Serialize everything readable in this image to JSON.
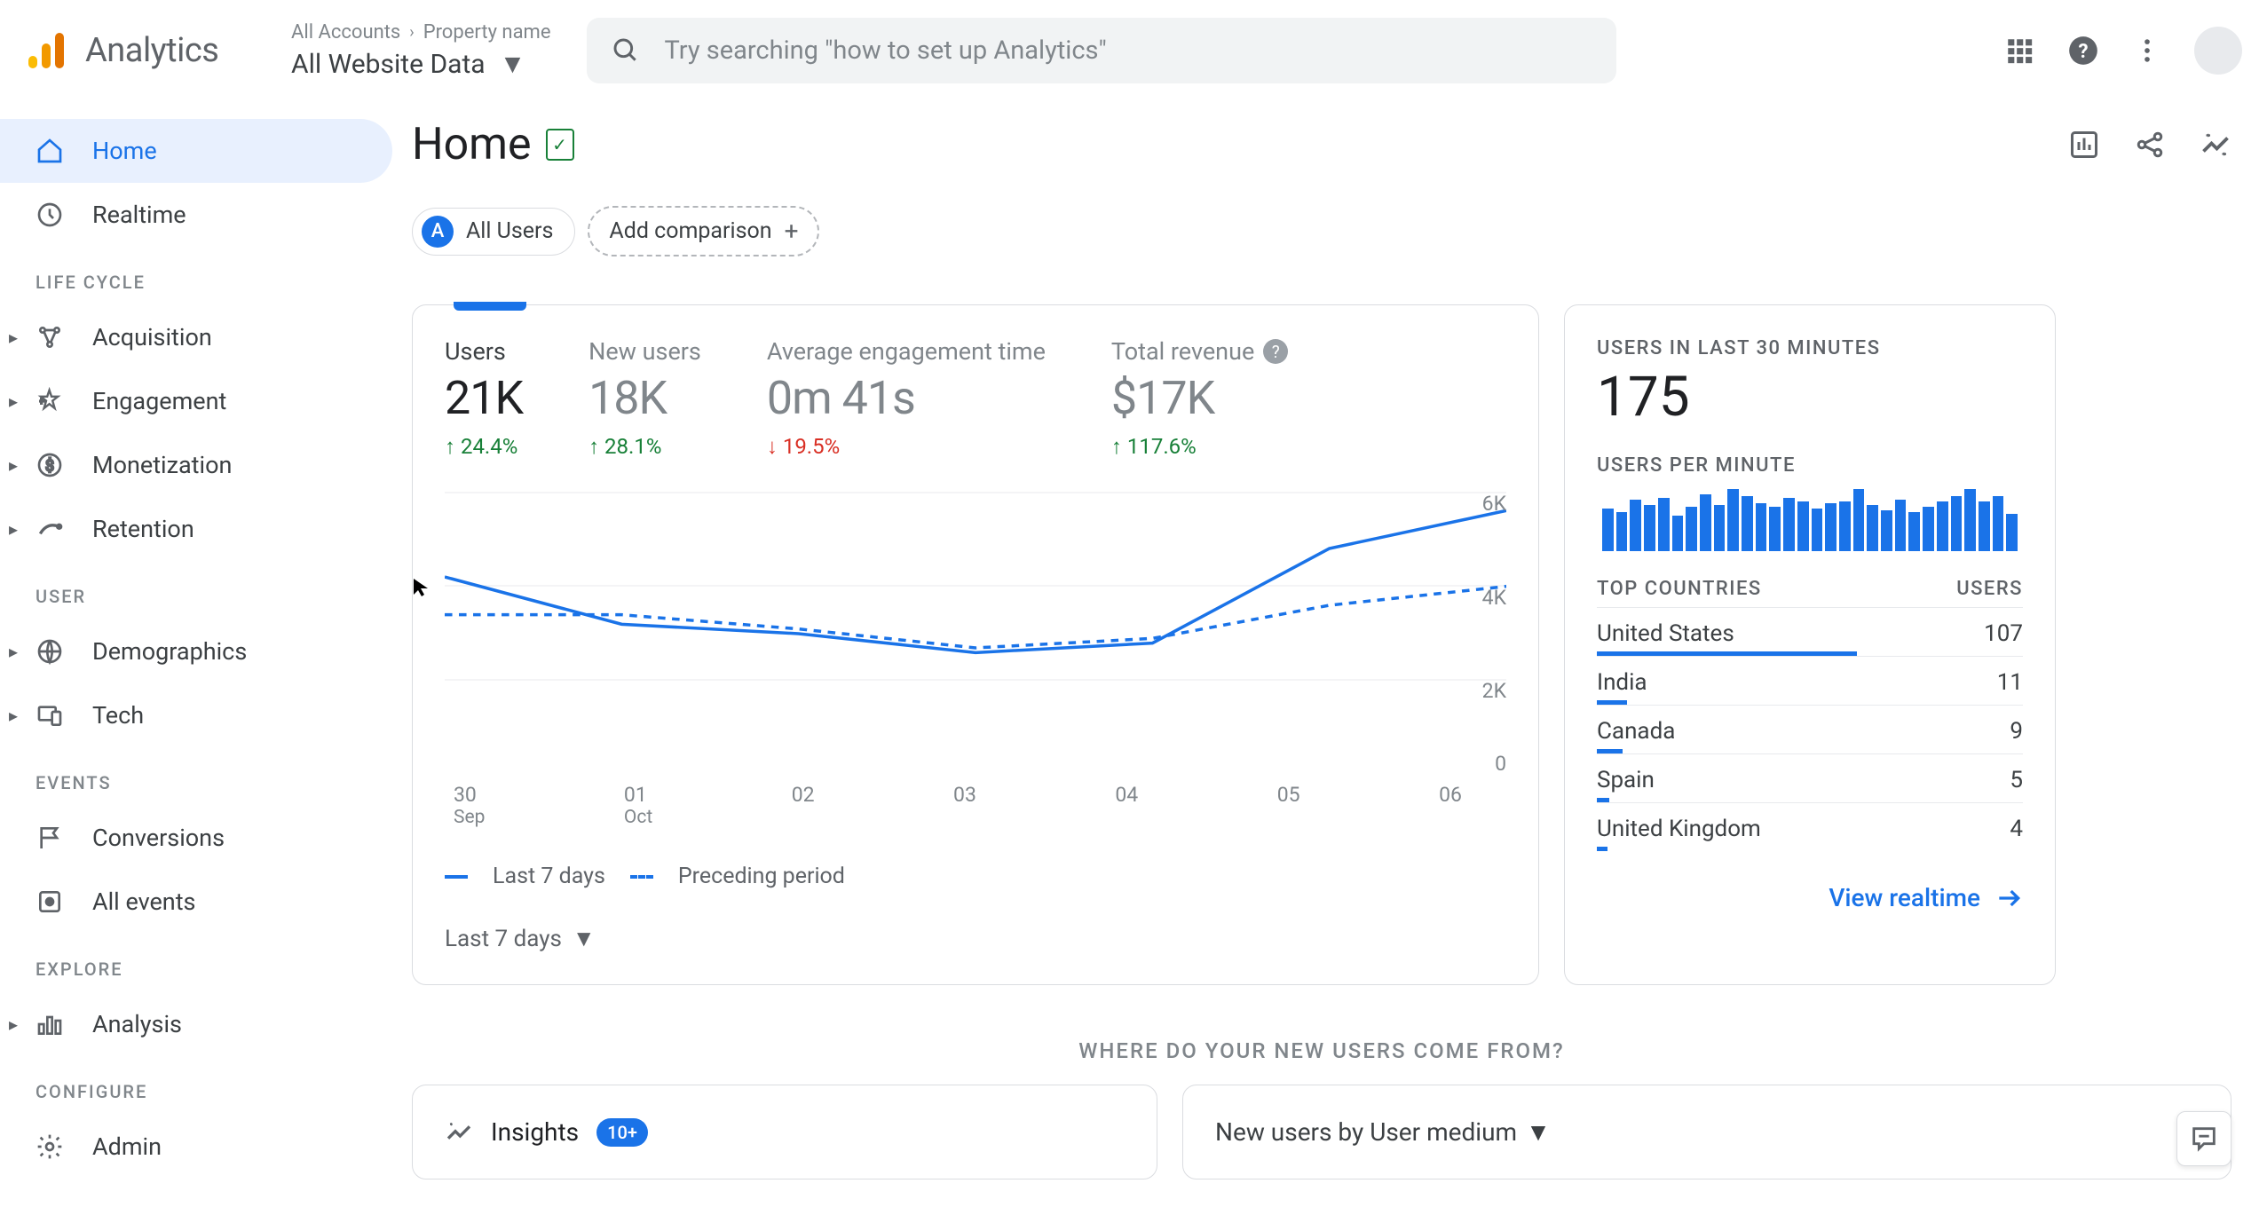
{
  "header": {
    "logo_text": "Analytics",
    "breadcrumb_accounts": "All Accounts",
    "breadcrumb_property": "Property name",
    "property_select": "All Website Data",
    "search_placeholder": "Try searching \"how to set up Analytics\""
  },
  "sidebar": {
    "home": "Home",
    "realtime": "Realtime",
    "sections": {
      "life_cycle": "LIFE CYCLE",
      "user": "USER",
      "events": "EVENTS",
      "explore": "EXPLORE",
      "configure": "CONFIGURE"
    },
    "items": {
      "acquisition": "Acquisition",
      "engagement": "Engagement",
      "monetization": "Monetization",
      "retention": "Retention",
      "demographics": "Demographics",
      "tech": "Tech",
      "conversions": "Conversions",
      "all_events": "All events",
      "analysis": "Analysis",
      "admin": "Admin"
    }
  },
  "page": {
    "title": "Home",
    "segment_all_users": "All Users",
    "add_comparison": "Add comparison"
  },
  "overview": {
    "metrics": [
      {
        "label": "Users",
        "value": "21K",
        "change": "24.4%",
        "dir": "up",
        "active": true
      },
      {
        "label": "New users",
        "value": "18K",
        "change": "28.1%",
        "dir": "up",
        "active": false
      },
      {
        "label": "Average engagement time",
        "value": "0m 41s",
        "change": "19.5%",
        "dir": "down",
        "active": false
      },
      {
        "label": "Total revenue",
        "value": "$17K",
        "change": "117.6%",
        "dir": "up",
        "active": false,
        "help": true
      }
    ],
    "chart_data": {
      "type": "line",
      "x_labels": [
        "30",
        "01",
        "02",
        "03",
        "04",
        "05",
        "06"
      ],
      "x_sub": [
        "Sep",
        "Oct",
        "",
        "",
        "",
        "",
        ""
      ],
      "ylim": [
        0,
        6000
      ],
      "y_ticks": [
        "6K",
        "4K",
        "2K",
        "0"
      ],
      "series": [
        {
          "name": "Last 7 days",
          "style": "solid",
          "values": [
            4200,
            3200,
            3000,
            2600,
            2800,
            4800,
            5600
          ]
        },
        {
          "name": "Preceding period",
          "style": "dash",
          "values": [
            3400,
            3400,
            3100,
            2700,
            2900,
            3600,
            4000
          ]
        }
      ]
    },
    "legend_current": "Last 7 days",
    "legend_prev": "Preceding period",
    "date_range": "Last 7 days"
  },
  "realtime": {
    "label_30m": "USERS IN LAST 30 MINUTES",
    "value_30m": "175",
    "label_per_min": "USERS PER MINUTE",
    "per_min_bars": [
      48,
      44,
      58,
      52,
      60,
      40,
      50,
      64,
      52,
      70,
      62,
      54,
      50,
      60,
      56,
      48,
      54,
      56,
      70,
      52,
      46,
      58,
      44,
      50,
      56,
      62,
      70,
      56,
      62,
      42
    ],
    "countries_header_left": "TOP COUNTRIES",
    "countries_header_right": "USERS",
    "countries": [
      {
        "name": "United States",
        "users": "107",
        "bar": 61
      },
      {
        "name": "India",
        "users": "11",
        "bar": 7
      },
      {
        "name": "Canada",
        "users": "9",
        "bar": 6
      },
      {
        "name": "Spain",
        "users": "5",
        "bar": 3
      },
      {
        "name": "United Kingdom",
        "users": "4",
        "bar": 2.5
      }
    ],
    "view_realtime": "View realtime"
  },
  "bottom": {
    "section_caption": "WHERE DO YOUR NEW USERS COME FROM?",
    "insights_label": "Insights",
    "insights_count": "10+",
    "medium_label": "New users by User medium"
  }
}
